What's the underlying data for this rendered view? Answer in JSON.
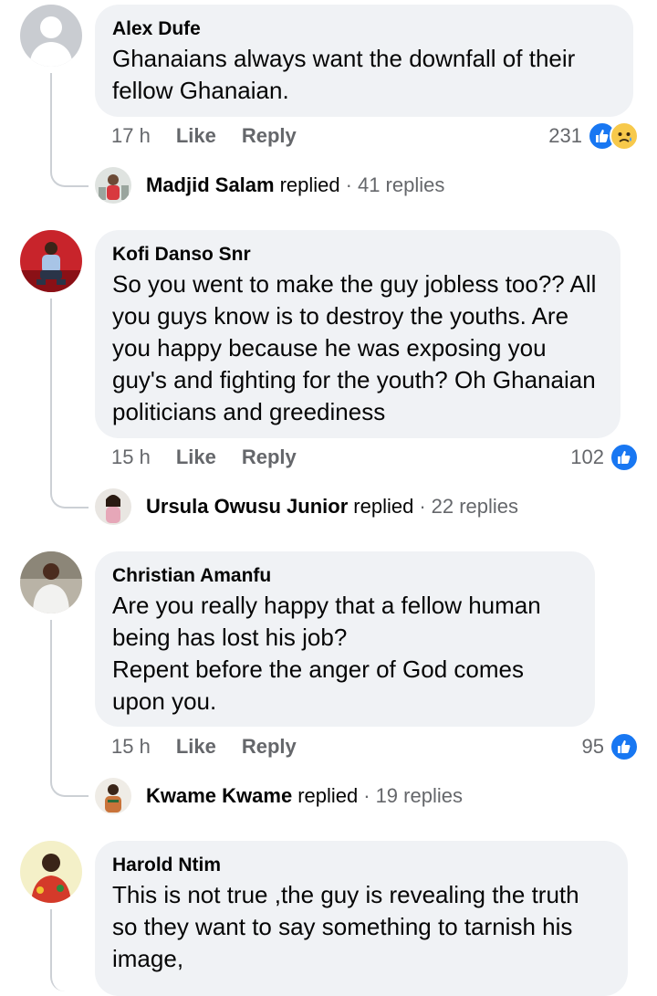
{
  "colors": {
    "bubble": "#f0f2f5",
    "meta": "#65676b",
    "like": "#1877f2",
    "sad": "#f7c94b"
  },
  "comments": [
    {
      "author": "Alex Dufe",
      "text": "Ghanaians always want the downfall of their fellow Ghanaian.",
      "time": "17 h",
      "like": "Like",
      "reply": "Reply",
      "reaction_count": "231",
      "reaction_icons": [
        "like-icon",
        "sad-icon"
      ],
      "replies": {
        "name": "Madjid Salam",
        "verb": "replied",
        "count": "41 replies"
      }
    },
    {
      "author": "Kofi Danso Snr",
      "text": "So you went to make the guy jobless too?? All you guys know is to destroy the youths. Are you happy because he was exposing you guy's and fighting for the youth? Oh Ghanaian politicians and greediness",
      "time": "15 h",
      "like": "Like",
      "reply": "Reply",
      "reaction_count": "102",
      "reaction_icons": [
        "like-icon"
      ],
      "replies": {
        "name": "Ursula Owusu Junior",
        "verb": "replied",
        "count": "22 replies"
      }
    },
    {
      "author": "Christian Amanfu",
      "text": "Are you really happy that a fellow human being has lost his job?\nRepent before the anger of God comes upon you.",
      "time": "15 h",
      "like": "Like",
      "reply": "Reply",
      "reaction_count": "95",
      "reaction_icons": [
        "like-icon"
      ],
      "replies": {
        "name": "Kwame Kwame",
        "verb": "replied",
        "count": "19 replies"
      }
    },
    {
      "author": "Harold Ntim",
      "text": "This is not true ,the guy is revealing the truth so they want to say something to tarnish his image,"
    }
  ],
  "separator": "·"
}
